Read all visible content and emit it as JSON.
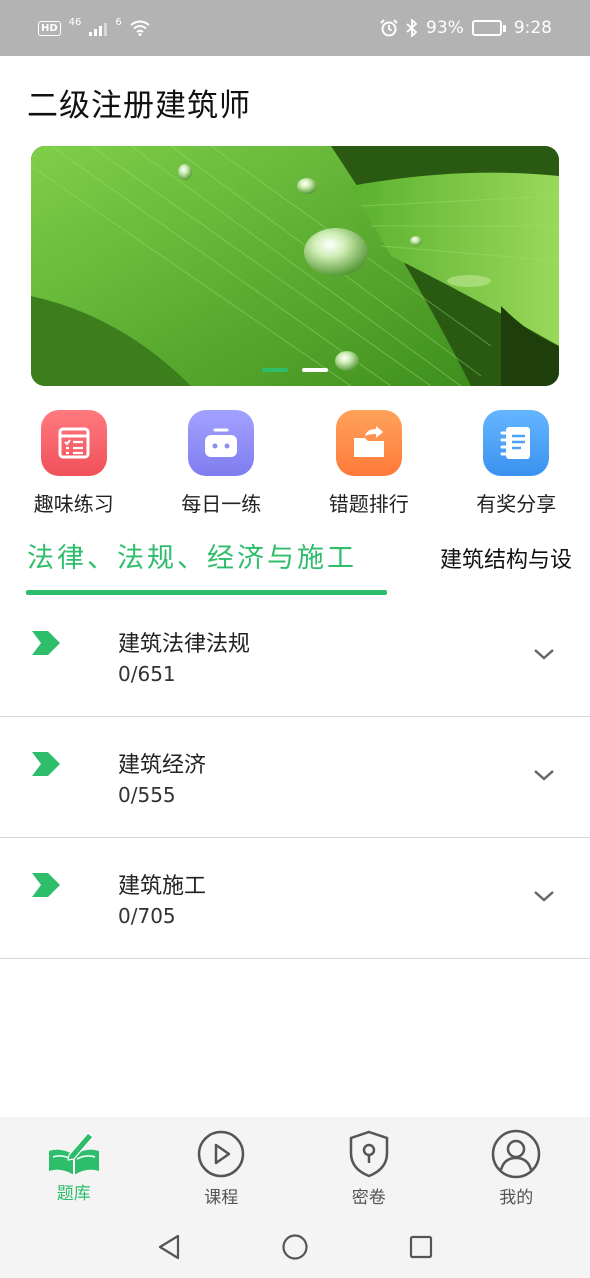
{
  "status_bar": {
    "hd": "HD",
    "network": "46",
    "wifi_badge": "6",
    "battery": "93%",
    "battery_level": 0.93,
    "time": "9:28"
  },
  "header": {
    "title": "二级注册建筑师"
  },
  "banner": {
    "slides": 3,
    "active_index": 0
  },
  "entries": [
    {
      "label": "趣味练习",
      "icon": "checklist-icon",
      "color": "#f25f68"
    },
    {
      "label": "每日一练",
      "icon": "robot-icon",
      "color": "#8e8cf6"
    },
    {
      "label": "错题排行",
      "icon": "folder-share-icon",
      "color": "#ff8a45"
    },
    {
      "label": "有奖分享",
      "icon": "notebook-icon",
      "color": "#4aa3f7"
    }
  ],
  "tabs": [
    {
      "label": "法律、法规、经济与施工",
      "active": true
    },
    {
      "label": "建筑结构与设",
      "active": false
    }
  ],
  "list": [
    {
      "name": "建筑法律法规",
      "count": "0/651"
    },
    {
      "name": "建筑经济",
      "count": "0/555"
    },
    {
      "name": "建筑施工",
      "count": "0/705"
    }
  ],
  "bottom_nav": [
    {
      "label": "题库",
      "icon": "book-pen-icon",
      "active": true
    },
    {
      "label": "课程",
      "icon": "play-circle-icon",
      "active": false
    },
    {
      "label": "密卷",
      "icon": "shield-lock-icon",
      "active": false
    },
    {
      "label": "我的",
      "icon": "user-circle-icon",
      "active": false
    }
  ],
  "accent_color": "#2ebd6b"
}
